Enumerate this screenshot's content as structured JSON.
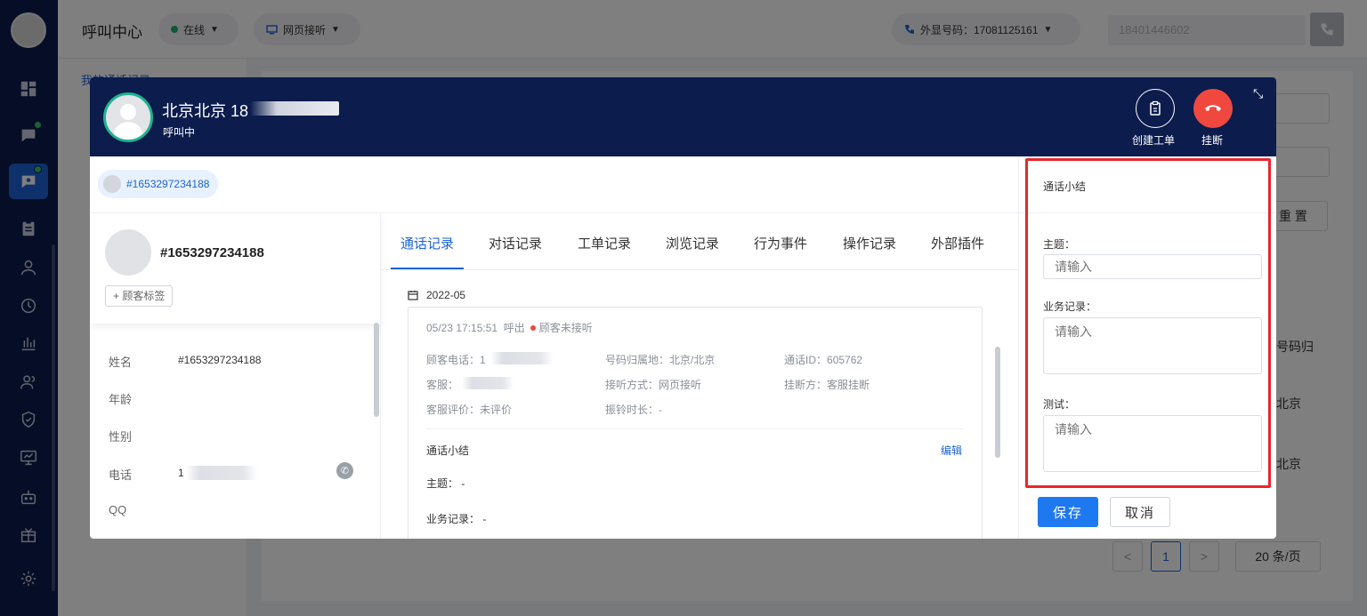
{
  "app": {
    "title": "呼叫中心",
    "status": "在线",
    "listen_mode": "网页接听",
    "outbound_number": "外显号码：17081125161",
    "dial_input": "18401446602"
  },
  "background": {
    "sidebar_item_1": "我的通话记录",
    "reset_button": "重 置",
    "column_header": "客号码归",
    "row1": "京北京",
    "row2": "京北京",
    "page_current": "1",
    "page_size": "20 条/页",
    "prev": "<",
    "next": ">"
  },
  "dialog": {
    "caller_name": "北京北京",
    "caller_number_prefix": "18",
    "call_status": "呼叫中",
    "create_ticket_label": "创建工单",
    "hangup_label": "挂断",
    "visitor_chip": "#1653297234188",
    "profile": {
      "id": "#1653297234188",
      "tag_button": "+ 顾客标签",
      "fields": [
        {
          "label": "姓名",
          "value": "#1653297234188"
        },
        {
          "label": "年龄",
          "value": ""
        },
        {
          "label": "性别",
          "value": ""
        },
        {
          "label": "电话",
          "value": "1"
        },
        {
          "label": "QQ",
          "value": ""
        }
      ]
    },
    "tabs": [
      "通话记录",
      "对话记录",
      "工单记录",
      "浏览记录",
      "行为事件",
      "操作记录",
      "外部插件"
    ],
    "active_tab": "通话记录",
    "month": "2022-05",
    "record": {
      "time": "05/23 17:15:51",
      "direction": "呼出",
      "result": "顾客未接听",
      "customer_phone_label": "顾客电话：",
      "customer_phone_value": "1",
      "region_label": "号码归属地：",
      "region_value": "北京/北京",
      "call_id_label": "通话ID：",
      "call_id_value": "605762",
      "agent_label": "客服：",
      "answer_mode_label": "接听方式：",
      "answer_mode_value": "网页接听",
      "hangup_side_label": "挂断方：",
      "hangup_side_value": "客服挂断",
      "rating_label": "客服评价：",
      "rating_value": "未评价",
      "ring_label": "振铃时长：",
      "ring_value": "-",
      "summary_title": "通话小结",
      "edit_link": "编辑",
      "topic_label": "主题：",
      "topic_value": "-",
      "biz_label": "业务记录：",
      "biz_value": "-"
    },
    "summary_panel": {
      "title": "通话小结",
      "topic_label": "主题：",
      "topic_placeholder": "请输入",
      "biz_label": "业务记录：",
      "biz_placeholder": "请输入",
      "test_label": "测试：",
      "test_placeholder": "请输入",
      "save_label": "保存",
      "cancel_label": "取消"
    }
  },
  "colors": {
    "nav_bg": "#0b1c4d",
    "accent": "#1e63d6",
    "hangup": "#f0483e",
    "highlight_box": "#e8262b"
  }
}
